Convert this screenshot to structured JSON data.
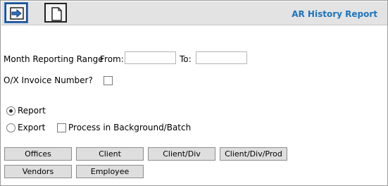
{
  "header": {
    "title": "AR History Report"
  },
  "toolbar": {
    "buttons": [
      {
        "icon": "arrow-right-icon"
      },
      {
        "icon": "document-icon"
      }
    ]
  },
  "form": {
    "month_range_label": "Month Reporting Range",
    "from_label": "From:",
    "from_value": "",
    "to_label": "To:",
    "to_value": "",
    "ox_invoice_label": "O/X Invoice Number?",
    "ox_invoice_checked": false,
    "report_label": "Report",
    "report_selected": true,
    "export_label": "Export",
    "export_selected": false,
    "background_label": "Process in Background/Batch",
    "background_checked": false
  },
  "buttons": {
    "row1": [
      "Offices",
      "Client",
      "Client/Div",
      "Client/Div/Prod"
    ],
    "row2": [
      "Vendors",
      "Employee"
    ]
  }
}
